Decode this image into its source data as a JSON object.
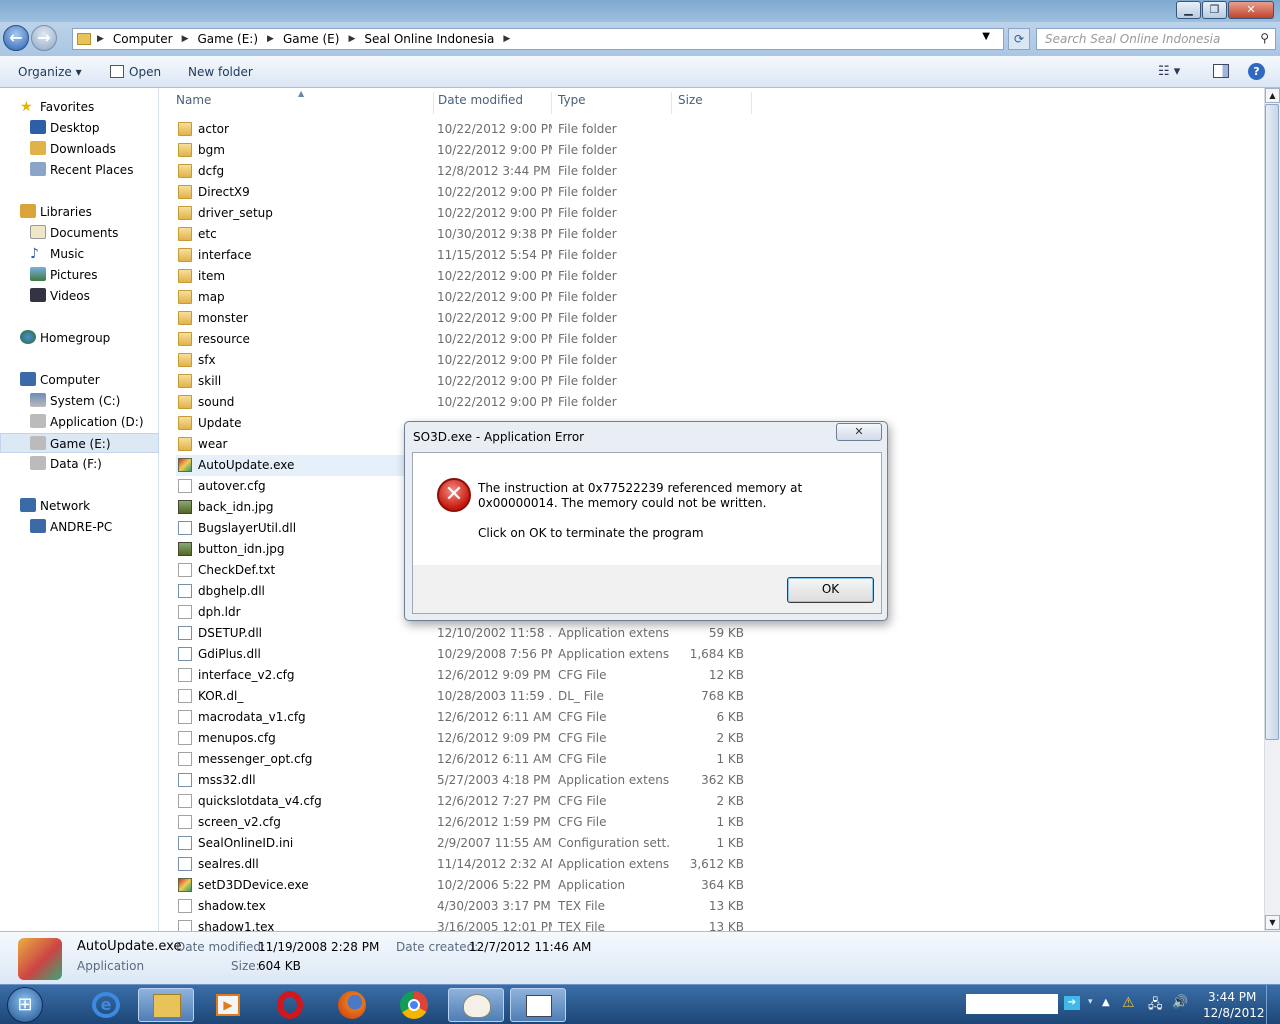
{
  "window": {
    "minimize": "▁",
    "maximize": "❐",
    "close": "✕"
  },
  "address": {
    "crumbs": [
      "Computer",
      "Game (E:)",
      "Game (E)",
      "Seal Online Indonesia"
    ],
    "search_placeholder": "Search Seal Online Indonesia"
  },
  "toolbar": {
    "organize": "Organize ▾",
    "open": "Open",
    "new_folder": "New folder"
  },
  "nav": {
    "favorites": "Favorites",
    "desktop": "Desktop",
    "downloads": "Downloads",
    "recent": "Recent Places",
    "libraries": "Libraries",
    "documents": "Documents",
    "music": "Music",
    "pictures": "Pictures",
    "videos": "Videos",
    "homegroup": "Homegroup",
    "computer": "Computer",
    "system": "System (C:)",
    "application": "Application (D:)",
    "game": "Game (E:)",
    "data": "Data (F:)",
    "network": "Network",
    "andre": "ANDRE-PC"
  },
  "columns": {
    "name": "Name",
    "date": "Date modified",
    "type": "Type",
    "size": "Size"
  },
  "files": [
    {
      "name": "actor",
      "date": "10/22/2012 9:00 PM",
      "type": "File folder",
      "size": "",
      "kind": "fold"
    },
    {
      "name": "bgm",
      "date": "10/22/2012 9:00 PM",
      "type": "File folder",
      "size": "",
      "kind": "fold"
    },
    {
      "name": "dcfg",
      "date": "12/8/2012 3:44 PM",
      "type": "File folder",
      "size": "",
      "kind": "fold"
    },
    {
      "name": "DirectX9",
      "date": "10/22/2012 9:00 PM",
      "type": "File folder",
      "size": "",
      "kind": "fold"
    },
    {
      "name": "driver_setup",
      "date": "10/22/2012 9:00 PM",
      "type": "File folder",
      "size": "",
      "kind": "fold"
    },
    {
      "name": "etc",
      "date": "10/30/2012 9:38 PM",
      "type": "File folder",
      "size": "",
      "kind": "fold"
    },
    {
      "name": "interface",
      "date": "11/15/2012 5:54 PM",
      "type": "File folder",
      "size": "",
      "kind": "fold"
    },
    {
      "name": "item",
      "date": "10/22/2012 9:00 PM",
      "type": "File folder",
      "size": "",
      "kind": "fold"
    },
    {
      "name": "map",
      "date": "10/22/2012 9:00 PM",
      "type": "File folder",
      "size": "",
      "kind": "fold"
    },
    {
      "name": "monster",
      "date": "10/22/2012 9:00 PM",
      "type": "File folder",
      "size": "",
      "kind": "fold"
    },
    {
      "name": "resource",
      "date": "10/22/2012 9:00 PM",
      "type": "File folder",
      "size": "",
      "kind": "fold"
    },
    {
      "name": "sfx",
      "date": "10/22/2012 9:00 PM",
      "type": "File folder",
      "size": "",
      "kind": "fold"
    },
    {
      "name": "skill",
      "date": "10/22/2012 9:00 PM",
      "type": "File folder",
      "size": "",
      "kind": "fold"
    },
    {
      "name": "sound",
      "date": "10/22/2012 9:00 PM",
      "type": "File folder",
      "size": "",
      "kind": "fold"
    },
    {
      "name": "Update",
      "date": "",
      "type": "",
      "size": "",
      "kind": "fold"
    },
    {
      "name": "wear",
      "date": "",
      "type": "",
      "size": "",
      "kind": "fold"
    },
    {
      "name": "AutoUpdate.exe",
      "date": "",
      "type": "",
      "size": "",
      "kind": "exe"
    },
    {
      "name": "autover.cfg",
      "date": "",
      "type": "",
      "size": "",
      "kind": "doc"
    },
    {
      "name": "back_idn.jpg",
      "date": "",
      "type": "",
      "size": "",
      "kind": "img"
    },
    {
      "name": "BugslayerUtil.dll",
      "date": "",
      "type": "",
      "size": "",
      "kind": "dll"
    },
    {
      "name": "button_idn.jpg",
      "date": "",
      "type": "",
      "size": "",
      "kind": "img"
    },
    {
      "name": "CheckDef.txt",
      "date": "",
      "type": "",
      "size": "",
      "kind": "doc"
    },
    {
      "name": "dbghelp.dll",
      "date": "",
      "type": "",
      "size": "",
      "kind": "dll"
    },
    {
      "name": "dph.ldr",
      "date": "",
      "type": "",
      "size": "",
      "kind": "doc"
    },
    {
      "name": "DSETUP.dll",
      "date": "12/10/2002 11:58 ...",
      "type": "Application extens...",
      "size": "59 KB",
      "kind": "dll"
    },
    {
      "name": "GdiPlus.dll",
      "date": "10/29/2008 7:56 PM",
      "type": "Application extens...",
      "size": "1,684 KB",
      "kind": "dll"
    },
    {
      "name": "interface_v2.cfg",
      "date": "12/6/2012 9:09 PM",
      "type": "CFG File",
      "size": "12 KB",
      "kind": "doc"
    },
    {
      "name": "KOR.dl_",
      "date": "10/28/2003 11:59 ...",
      "type": "DL_ File",
      "size": "768 KB",
      "kind": "doc"
    },
    {
      "name": "macrodata_v1.cfg",
      "date": "12/6/2012 6:11 AM",
      "type": "CFG File",
      "size": "6 KB",
      "kind": "doc"
    },
    {
      "name": "menupos.cfg",
      "date": "12/6/2012 9:09 PM",
      "type": "CFG File",
      "size": "2 KB",
      "kind": "doc"
    },
    {
      "name": "messenger_opt.cfg",
      "date": "12/6/2012 6:11 AM",
      "type": "CFG File",
      "size": "1 KB",
      "kind": "doc"
    },
    {
      "name": "mss32.dll",
      "date": "5/27/2003 4:18 PM",
      "type": "Application extens...",
      "size": "362 KB",
      "kind": "dll"
    },
    {
      "name": "quickslotdata_v4.cfg",
      "date": "12/6/2012 7:27 PM",
      "type": "CFG File",
      "size": "2 KB",
      "kind": "doc"
    },
    {
      "name": "screen_v2.cfg",
      "date": "12/6/2012 1:59 PM",
      "type": "CFG File",
      "size": "1 KB",
      "kind": "doc"
    },
    {
      "name": "SealOnlineID.ini",
      "date": "2/9/2007 11:55 AM",
      "type": "Configuration sett...",
      "size": "1 KB",
      "kind": "dll"
    },
    {
      "name": "sealres.dll",
      "date": "11/14/2012 2:32 AM",
      "type": "Application extens...",
      "size": "3,612 KB",
      "kind": "dll"
    },
    {
      "name": "setD3DDevice.exe",
      "date": "10/2/2006 5:22 PM",
      "type": "Application",
      "size": "364 KB",
      "kind": "exe"
    },
    {
      "name": "shadow.tex",
      "date": "4/30/2003 3:17 PM",
      "type": "TEX File",
      "size": "13 KB",
      "kind": "doc"
    },
    {
      "name": "shadow1.tex",
      "date": "3/16/2005 12:01 PM",
      "type": "TEX File",
      "size": "13 KB",
      "kind": "doc"
    }
  ],
  "details": {
    "name": "AutoUpdate.exe",
    "kind": "Application",
    "modified_label": "Date modified:",
    "modified": "11/19/2008 2:28 PM",
    "created_label": "Date created:",
    "created": "12/7/2012 11:46 AM",
    "size_label": "Size:",
    "size": "604 KB"
  },
  "dialog": {
    "title": "SO3D.exe - Application Error",
    "message": "The instruction at 0x77522239 referenced memory at 0x00000014. The memory could not be written.",
    "instruction": "Click on OK to terminate the program",
    "ok": "OK",
    "close": "✕"
  },
  "clock": {
    "time": "3:44 PM",
    "date": "12/8/2012"
  }
}
